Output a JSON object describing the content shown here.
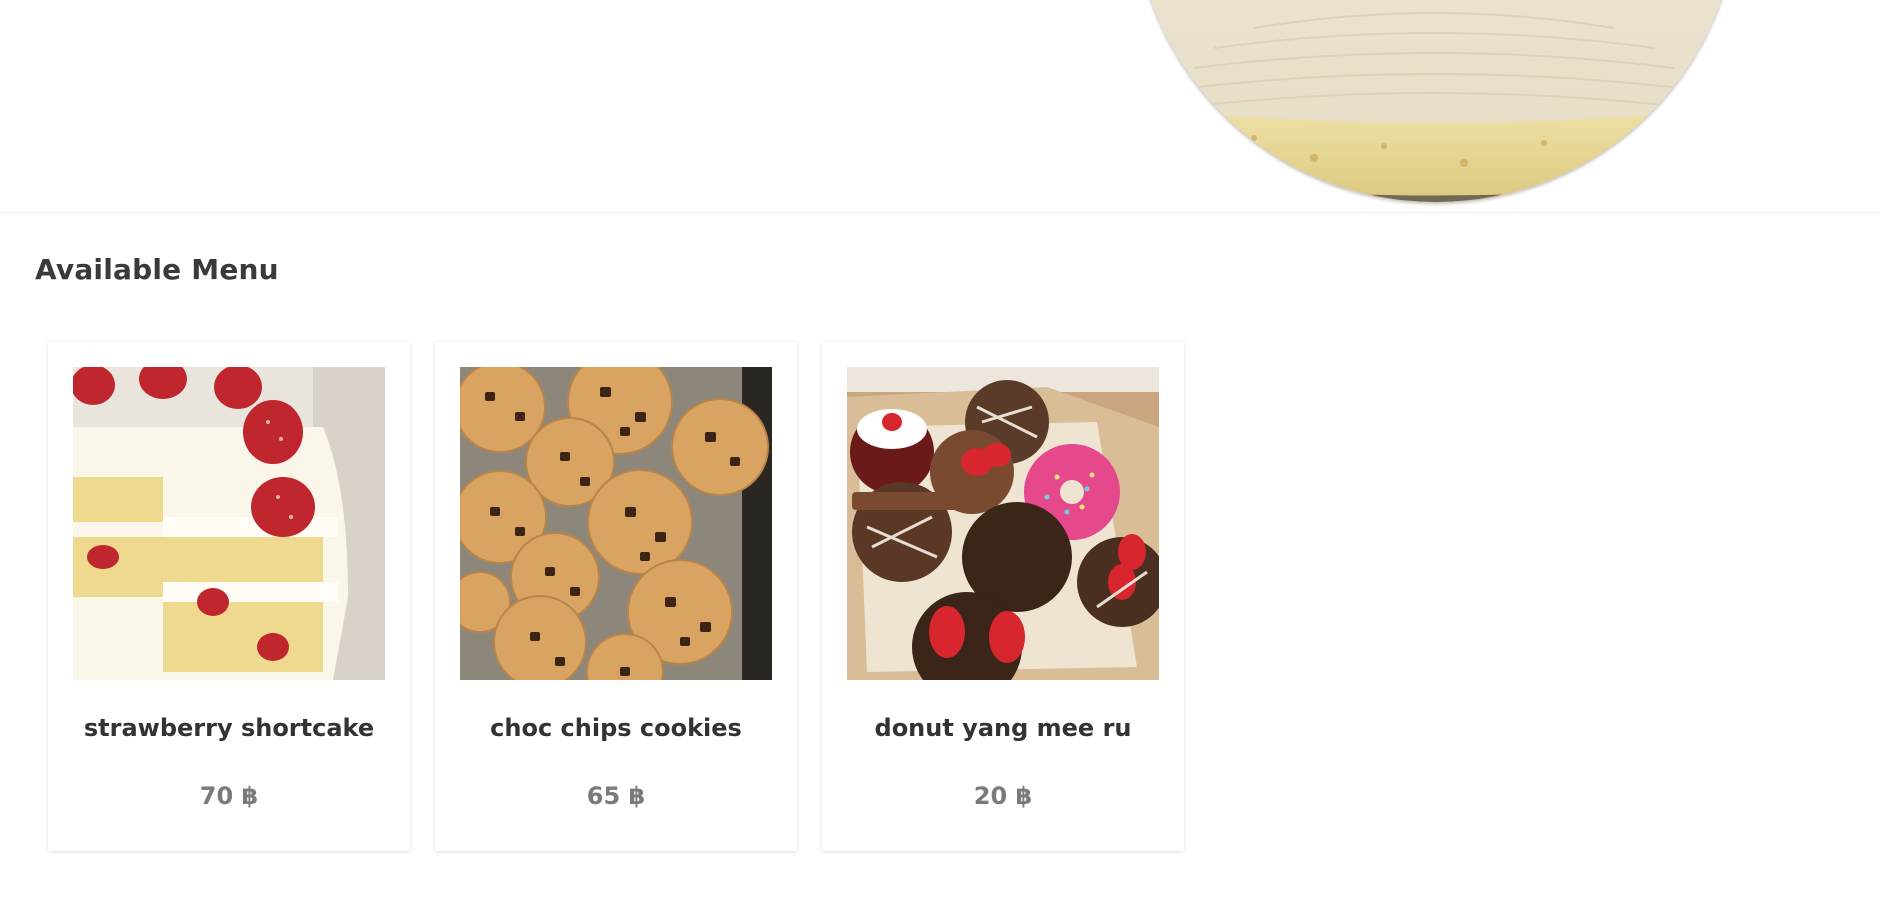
{
  "hero": {
    "image_icon": "cake-photo"
  },
  "menu": {
    "title": "Available Menu",
    "currency_symbol": "฿",
    "items": [
      {
        "name": "strawberry shortcake",
        "price": "70 ฿",
        "image_icon": "strawberry-shortcake-photo"
      },
      {
        "name": "choc chips cookies",
        "price": "65 ฿",
        "image_icon": "chocolate-chip-cookies-photo"
      },
      {
        "name": "donut yang mee ru",
        "price": "20 ฿",
        "image_icon": "donuts-box-photo"
      }
    ]
  },
  "colors": {
    "background": "#ffffff",
    "title_text": "#3a3a3a",
    "item_name_text": "#333333",
    "price_text": "#7a7a7a"
  }
}
